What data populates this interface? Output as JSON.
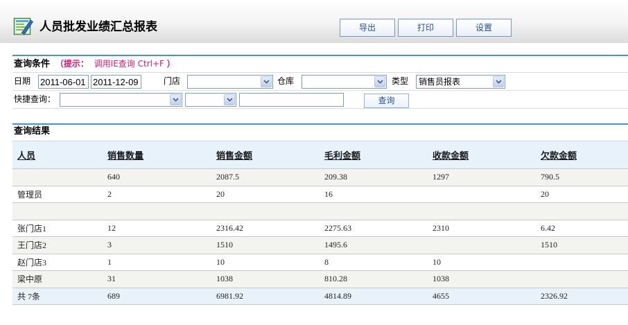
{
  "header": {
    "title": "人员批发业绩汇总报表",
    "icon": "report-edit-icon",
    "export_label": "导出",
    "print_label": "打印",
    "settings_label": "设置"
  },
  "query": {
    "section_title": "查询条件",
    "hint_open": "（提示：",
    "hint_text": "调用IE查询 Ctrl+F",
    "hint_close": "）",
    "date_label": "日期",
    "date_from": "2011-06-01",
    "date_to": "2011-12-09",
    "store_label": "门店",
    "store_value": "",
    "warehouse_label": "仓库",
    "warehouse_value": "",
    "type_label": "类型",
    "type_value": "销售员报表",
    "quick_label": "快捷查询：",
    "quick_field_value": "",
    "quick_operator_value": "",
    "quick_keyword": "",
    "search_label": "查询",
    "select_icon": "chevron-down-icon"
  },
  "results": {
    "section_title": "查询结果",
    "columns": [
      "人员",
      "销售数量",
      "销售金额",
      "毛利金额",
      "收款金额",
      "欠款金额"
    ],
    "rows": [
      [
        "",
        "640",
        "2087.5",
        "209.38",
        "1297",
        "790.5"
      ],
      [
        "管理员",
        "2",
        "20",
        "16",
        "",
        "20"
      ],
      [
        "",
        "",
        "",
        "",
        "",
        ""
      ],
      [
        "张门店1",
        "12",
        "2316.42",
        "2275.63",
        "2310",
        "6.42"
      ],
      [
        "王门店2",
        "3",
        "1510",
        "1495.6",
        "",
        "1510"
      ],
      [
        "赵门店3",
        "1",
        "10",
        "8",
        "10",
        ""
      ],
      [
        "梁中原",
        "31",
        "1038",
        "810.28",
        "1038",
        ""
      ]
    ],
    "total_row": [
      "共 7条",
      "689",
      "6981.92",
      "4814.89",
      "4655",
      "2326.92"
    ]
  },
  "colors": {
    "section_rule": "#4393cf",
    "hint": "#d4197a",
    "header_row_bg": "#e8f2fb",
    "button_text": "#24508f"
  }
}
